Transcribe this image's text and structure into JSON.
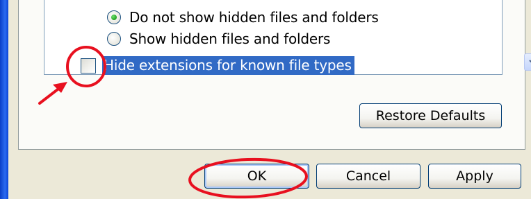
{
  "folder_options": {
    "advanced_settings": {
      "items": [
        {
          "type": "radio",
          "label": "Do not show hidden files and folders",
          "checked": true
        },
        {
          "type": "radio",
          "label": "Show hidden files and folders",
          "checked": false
        },
        {
          "type": "checkbox",
          "label": "Hide extensions for known file types",
          "checked": false,
          "selected": true
        }
      ]
    },
    "restore_defaults_label": "Restore Defaults"
  },
  "dialog_buttons": {
    "ok_label": "OK",
    "cancel_label": "Cancel",
    "apply_label": "Apply"
  },
  "colors": {
    "annotation_red": "#e8101f",
    "selection_blue": "#316ac5",
    "dialog_background": "#ece9d8"
  }
}
